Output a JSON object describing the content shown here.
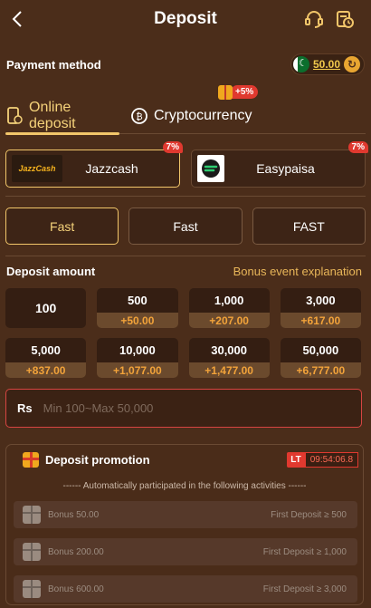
{
  "header": {
    "title": "Deposit"
  },
  "payment": {
    "label": "Payment method",
    "balance": "50.00"
  },
  "tabs": [
    {
      "label": "Online deposit",
      "active": true
    },
    {
      "label": "Cryptocurrency",
      "badge": "+5%"
    }
  ],
  "channels": [
    {
      "name": "Jazzcash",
      "badge": "7%",
      "logo_text": "JazzCash",
      "active": true
    },
    {
      "name": "Easypaisa",
      "badge": "7%"
    }
  ],
  "speeds": [
    "Fast",
    "Fast",
    "FAST"
  ],
  "amount": {
    "label": "Deposit amount",
    "link": "Bonus event explanation"
  },
  "amounts": [
    {
      "value": "100",
      "bonus": ""
    },
    {
      "value": "500",
      "bonus": "+50.00"
    },
    {
      "value": "1,000",
      "bonus": "+207.00"
    },
    {
      "value": "3,000",
      "bonus": "+617.00"
    },
    {
      "value": "5,000",
      "bonus": "+837.00"
    },
    {
      "value": "10,000",
      "bonus": "+1,077.00"
    },
    {
      "value": "30,000",
      "bonus": "+1,477.00"
    },
    {
      "value": "50,000",
      "bonus": "+6,777.00"
    }
  ],
  "input": {
    "currency": "Rs",
    "placeholder": "Min 100~Max 50,000"
  },
  "promotion": {
    "title": "Deposit promotion",
    "lt": "LT",
    "timer": "09:54:06.8",
    "note": "------ Automatically participated in the following activities ------",
    "items": [
      {
        "name": "Bonus 50.00",
        "cond": "First Deposit ≥ 500"
      },
      {
        "name": "Bonus 200.00",
        "cond": "First Deposit ≥ 1,000"
      },
      {
        "name": "Bonus 600.00",
        "cond": "First Deposit ≥ 3,000"
      }
    ]
  },
  "colors": {
    "background": "#4b2d1a",
    "accent": "#f2c66a",
    "bonus": "#f2a33a",
    "danger": "#e0392f"
  }
}
